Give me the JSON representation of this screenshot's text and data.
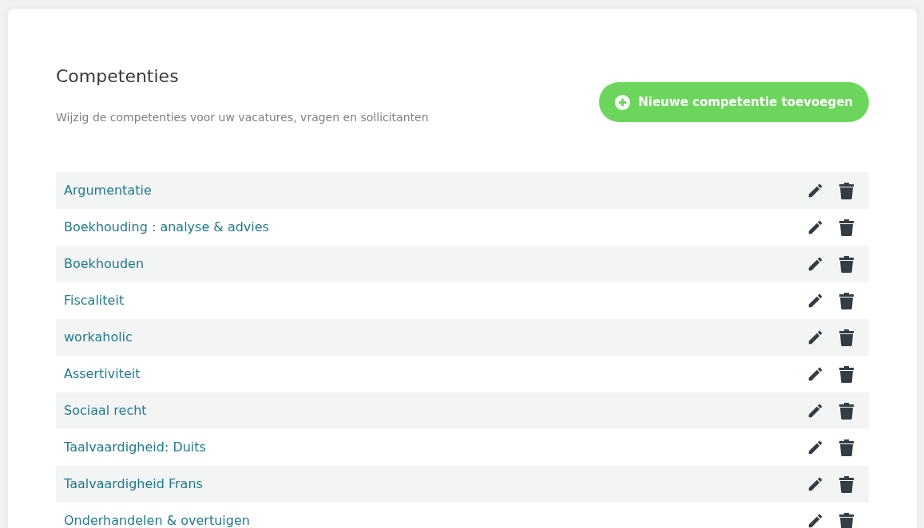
{
  "header": {
    "title": "Competenties",
    "subtitle": "Wijzig de competenties voor uw vacatures, vragen en sollicitanten",
    "add_button": "Nieuwe competentie toevoegen"
  },
  "competencies": [
    {
      "name": "Argumentatie"
    },
    {
      "name": "Boekhouding : analyse & advies"
    },
    {
      "name": "Boekhouden"
    },
    {
      "name": "Fiscaliteit"
    },
    {
      "name": "workaholic"
    },
    {
      "name": "Assertiviteit"
    },
    {
      "name": "Sociaal recht"
    },
    {
      "name": "Taalvaardigheid: Duits"
    },
    {
      "name": "Taalvaardigheid Frans"
    },
    {
      "name": "Onderhandelen & overtuigen"
    }
  ]
}
